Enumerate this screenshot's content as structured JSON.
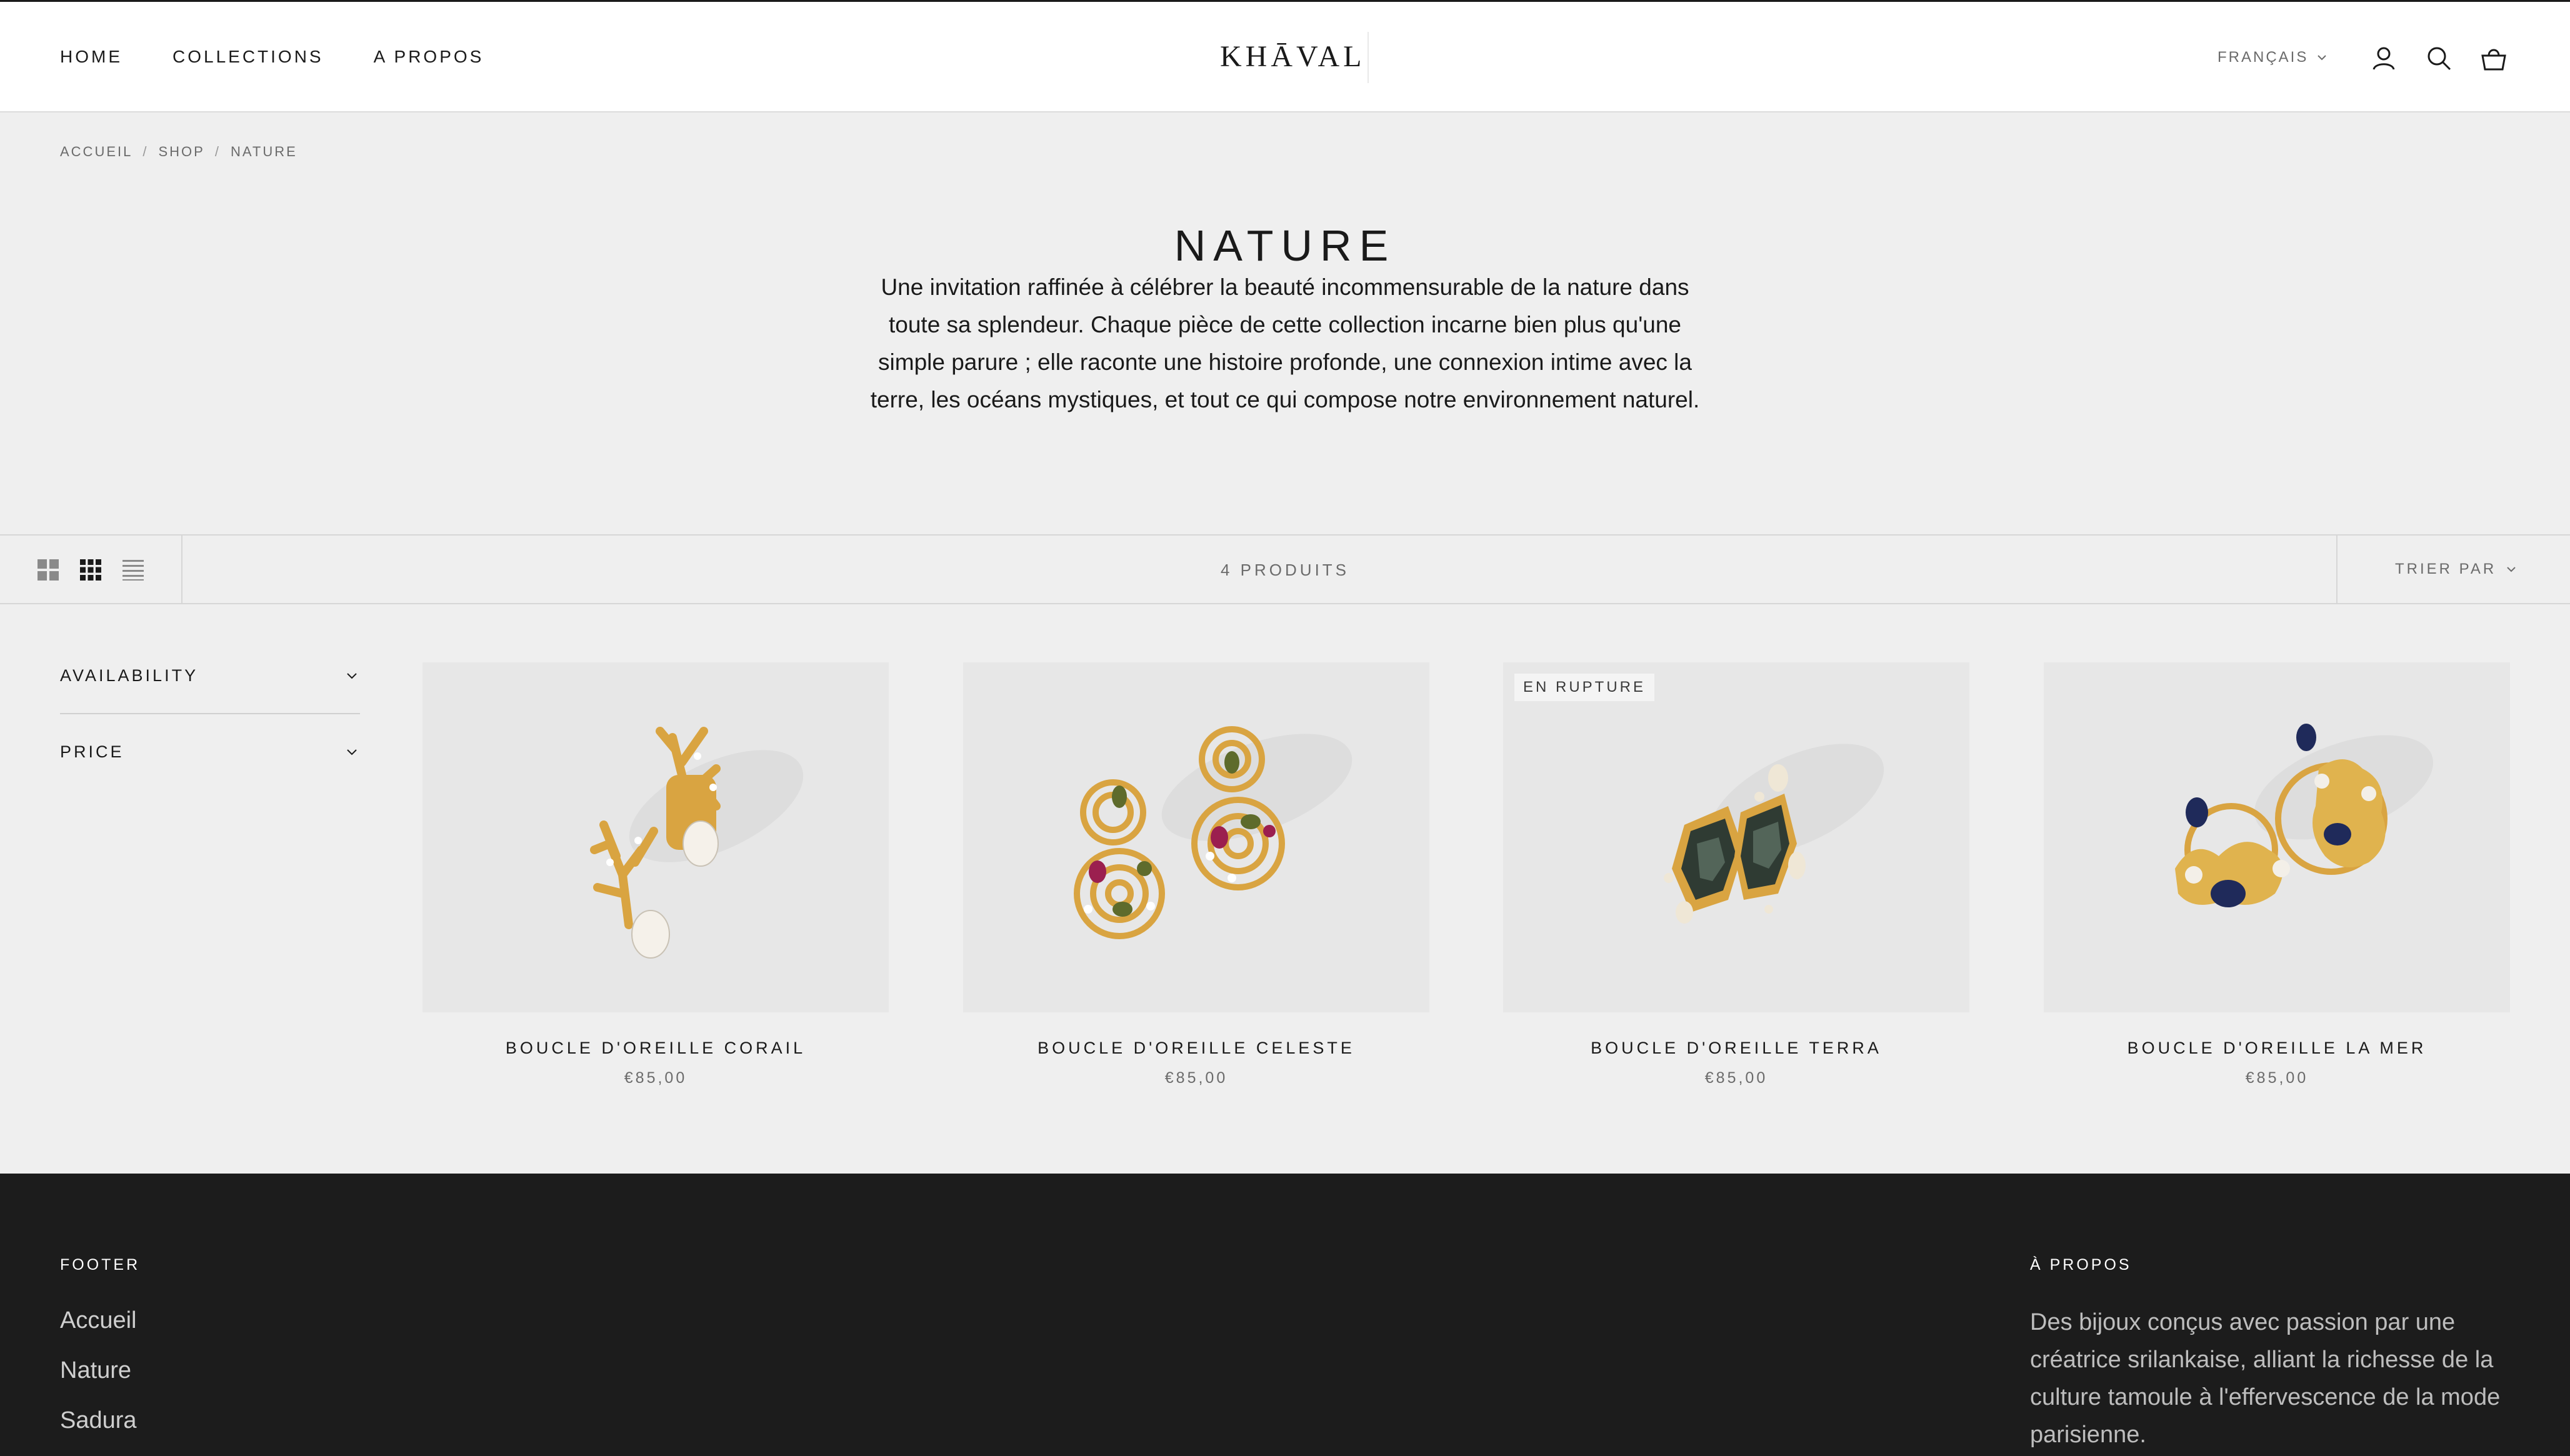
{
  "header": {
    "nav": [
      "HOME",
      "COLLECTIONS",
      "A PROPOS"
    ],
    "logo": "KHĀVAL",
    "language": "FRANÇAIS",
    "icons": [
      "user-icon",
      "search-icon",
      "bag-icon"
    ]
  },
  "breadcrumb": [
    "ACCUEIL",
    "SHOP",
    "NATURE"
  ],
  "breadcrumb_separator": "/",
  "collection": {
    "title": "NATURE",
    "description": "Une invitation raffinée à célébrer la beauté incommensurable de la nature dans toute sa splendeur. Chaque pièce de cette collection incarne bien plus qu'une simple parure ; elle raconte une histoire profonde, une connexion intime avec la terre, les océans mystiques, et tout ce qui compose notre environnement naturel."
  },
  "toolbar": {
    "product_count": "4 PRODUITS",
    "sort_label": "TRIER PAR",
    "views": [
      "grid-large-icon",
      "grid-small-icon",
      "list-icon"
    ]
  },
  "filters": [
    "AVAILABILITY",
    "PRICE"
  ],
  "products": [
    {
      "name": "BOUCLE D'OREILLE CORAIL",
      "price": "€85,00",
      "badge": ""
    },
    {
      "name": "BOUCLE D'OREILLE CELESTE",
      "price": "€85,00",
      "badge": ""
    },
    {
      "name": "BOUCLE D'OREILLE TERRA",
      "price": "€85,00",
      "badge": "EN RUPTURE"
    },
    {
      "name": "BOUCLE D'OREILLE LA MER",
      "price": "€85,00",
      "badge": ""
    }
  ],
  "footer": {
    "menu_heading": "FOOTER",
    "links": [
      "Accueil",
      "Nature",
      "Sadura"
    ],
    "about_heading": "À PROPOS",
    "about_text": "Des bijoux conçus avec passion par une créatrice srilankaise, alliant la richesse de la culture tamoule à l'effervescence de la mode parisienne."
  },
  "colors": {
    "background": "#efefef",
    "header": "#ffffff",
    "footer": "#1c1c1c",
    "gold": "#d9a441"
  }
}
